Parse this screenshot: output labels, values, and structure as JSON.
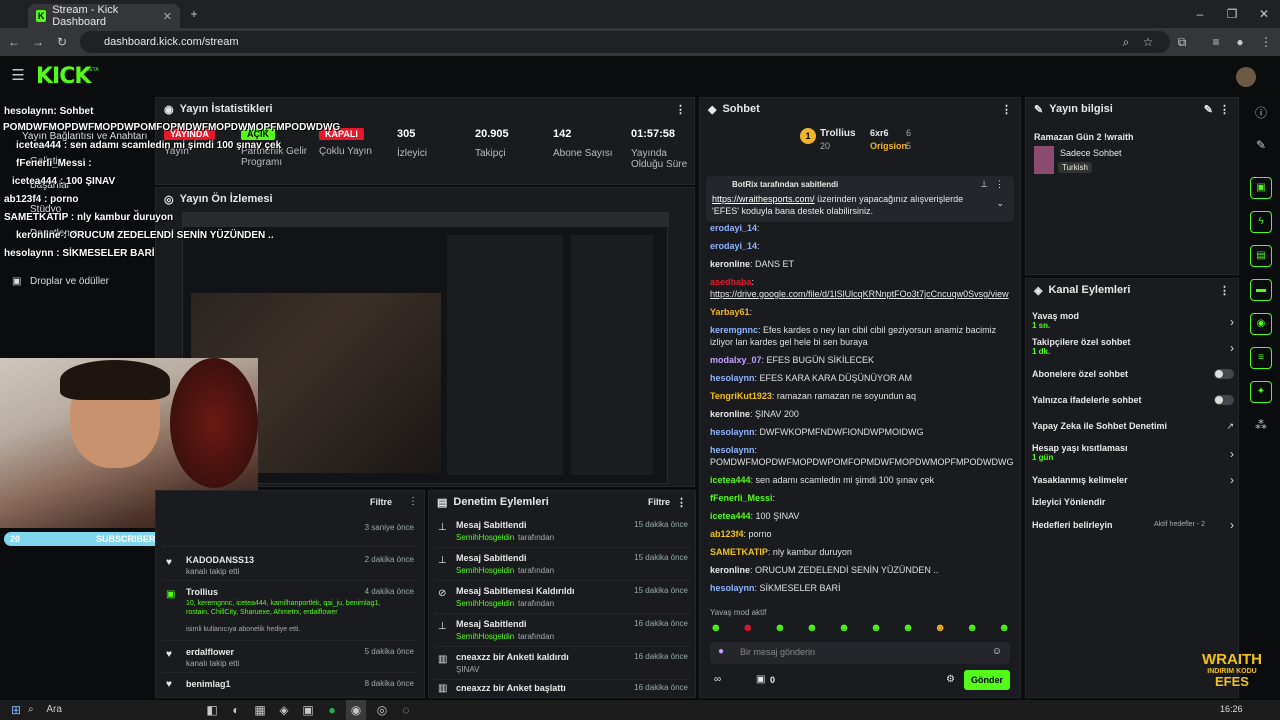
{
  "browser": {
    "tab_title": "Stream - Kick Dashboard",
    "url": "dashboard.kick.com/stream",
    "search_text": "Ara",
    "clock": "16:26"
  },
  "kick": {
    "logo": "KICK",
    "logo_sup": "BETA"
  },
  "nav": {
    "item1": "Yayın Bağlantısı ve Anahtarı",
    "item2": "Geliştir",
    "item3": "Başarılar",
    "item4": "Stüdyo",
    "item5": "Denetleme",
    "item6": "Droplar ve ödüller"
  },
  "stats": {
    "title": "Yayın İstatistikleri",
    "live_badge": "YAYINDA",
    "live_label": "Yayın",
    "partner_badge": "AÇIK",
    "partner_label": "Partnerlik Gelir Programı",
    "multi_badge": "KAPALI",
    "multi_label": "Çoklu Yayın",
    "viewers": "305",
    "viewers_label": "İzleyici",
    "followers": "20.905",
    "followers_label": "Takipçi",
    "subs": "142",
    "subs_label": "Abone Sayısı",
    "uptime": "01:57:58",
    "uptime_label": "Yayında Olduğu Süre"
  },
  "preview": {
    "title": "Yayın Ön İzlemesi"
  },
  "activity": {
    "filter": "Filtre",
    "rows": [
      {
        "name": "",
        "sub": "",
        "time": "3 saniye önce"
      },
      {
        "name": "KADODANSS13",
        "sub": "kanalı takip etti",
        "time": "2 dakika önce"
      },
      {
        "name": "Trollius",
        "sub": "10, keremgnnc, icetea444, kamilhanportlek, qai_ju, benimlag1, rostain, ChillCity, Sharuexe, Ahmetrx, erdalflower",
        "sub2": "isimli kullanıcıya abonelik hediye etti.",
        "time": "4 dakika önce"
      },
      {
        "name": "erdalflower",
        "sub": "kanalı takip etti",
        "time": "5 dakika önce"
      },
      {
        "name": "benimlag1",
        "sub": "",
        "time": "8 dakika önce"
      }
    ]
  },
  "mod": {
    "title": "Denetim Eylemleri",
    "filter": "Filtre",
    "rows": [
      {
        "name": "Mesaj Sabitlendi",
        "by": "SemihHosgeldin",
        "suffix": "tarafından",
        "time": "15 dakika önce"
      },
      {
        "name": "Mesaj Sabitlendi",
        "by": "SemihHosgeldin",
        "suffix": "tarafından",
        "time": "15 dakika önce"
      },
      {
        "name": "Mesaj Sabitlemesi Kaldırıldı",
        "by": "SemihHosgeldin",
        "suffix": "tarafından",
        "time": "15 dakika önce"
      },
      {
        "name": "Mesaj Sabitlendi",
        "by": "SemihHosgeldin",
        "suffix": "tarafından",
        "time": "16 dakika önce"
      },
      {
        "name": "cneaxzz bir Anketi kaldırdı",
        "by": "ŞINAV",
        "suffix": "",
        "time": "16 dakika önce"
      },
      {
        "name": "cneaxzz bir Anket başlattı",
        "by": "",
        "suffix": "",
        "time": "16 dakika önce"
      }
    ]
  },
  "chat": {
    "title": "Sohbet",
    "top_user": "Trollius",
    "top_count": "20",
    "u2": "6xr6",
    "u2c": "6",
    "u3": "Origsion",
    "u3c": "5",
    "pinned_by": "BotRix tarafından sabitlendi",
    "pinned_link": "https://wraithesports.com/",
    "pinned_text": "üzerinden yapacağınız alışverişlerde 'EFES' koduyla bana destek olabilirsiniz.",
    "slow_mode_note": "Yavaş mod aktif",
    "placeholder": "Bir mesaj gönderin",
    "send": "Gönder",
    "points": "0",
    "lines": [
      {
        "user": "erodayi_14",
        "text": ":"
      },
      {
        "user": "erodayi_14",
        "text": ":"
      },
      {
        "user": "keronline",
        "text": ": DANS ET"
      },
      {
        "user": "asedbaba",
        "text": ":"
      },
      {
        "user": "",
        "text": "https://drive.google.com/file/d/1lSlUlcqKRNnptFOo3t7jcCncuqw0Svsg/view"
      },
      {
        "user": "Yarbay61",
        "text": ":"
      },
      {
        "user": "keremgnnc",
        "text": ": Efes kardes o ney lan cibil cibil geziyorsun anamiz bacimiz izliyor lan kardes gel hele bi sen buraya"
      },
      {
        "user": "modalxy_07",
        "text": ": EFES BUGÜN SİKİLECEK"
      },
      {
        "user": "hesolaynn",
        "text": ": EFES KARA KARA DÜŞÜNÜYOR AM"
      },
      {
        "user": "TengriKut1923",
        "text": ": ramazan ramazan ne soyundun aq"
      },
      {
        "user": "keronline",
        "text": ": ŞINAV 200"
      },
      {
        "user": "hesolaynn",
        "text": ": DWFWKOPMFNDWFIONDWPMOIDWG"
      },
      {
        "user": "hesolaynn",
        "text": ": POMDWFMOPDWFMOPDWPOMFOPMDWFMOPDWMOPFMPODWDWG"
      },
      {
        "user": "icetea444",
        "text": ": sen adamı scamledin mi şimdi 100 şınav çek"
      },
      {
        "user": "fFenerli_Messi",
        "text": ":"
      },
      {
        "user": "icetea444",
        "text": ": 100 ŞINAV"
      },
      {
        "user": "ab123f4",
        "text": ": porno"
      },
      {
        "user": "SAMETKATIP",
        "text": ": nly kambur duruyon"
      },
      {
        "user": "keronline",
        "text": ": ORUCUM ZEDELENDİ SENİN YÜZÜNDEN .."
      },
      {
        "user": "hesolaynn",
        "text": ": SİKMESELER BARİ"
      }
    ]
  },
  "info": {
    "title": "Yayın bilgisi",
    "stream_title": "Ramazan Gün 2 !wraith",
    "category": "Sadece Sohbet",
    "language": "Turkish"
  },
  "channel": {
    "title": "Kanal Eylemleri",
    "slow": "Yavaş mod",
    "slow_val": "1 sn.",
    "followers_only": "Takipçilere özel sohbet",
    "followers_val": "1 dk.",
    "subs_only": "Abonelere özel sohbet",
    "emotes_only": "Yalnızca ifadelerle sohbet",
    "ai": "Yapay Zeka ile Sohbet Denetimi",
    "age": "Hesap yaşı kısıtlaması",
    "age_val": "1 gün",
    "banned": "Yasaklanmış kelimeler",
    "redirect": "İzleyici Yönlendir",
    "goals": "Hedefleri belirleyin",
    "goals_val": "Aktif hedefler - 2"
  },
  "overlay": {
    "l1": "hesolaynn: Sohbet",
    "l2": "POMDWFMOPDWFMOPDWPOMFOPMDWFMOPDWMOPFMPODWDWG",
    "l3": "icetea444 : sen adamı scamledin mi şimdi 100 şınav çek",
    "l4": "fFenerli_Messi :",
    "l5": "icetea444 : 100 ŞINAV",
    "l6": "ab123f4 : porno",
    "l7": "SAMETKATIP : nly kambur duruyon",
    "l8": "keronline : ORUCUM ZEDELENDİ SENİN YÜZÜNDEN ..",
    "l9": "hesolaynn : SİKMESELER BARİ",
    "sub_left": "20",
    "sub_label": "SUBSCRIBERS",
    "sub_right": "7",
    "wraith": "WRAITH",
    "wraith2": "INDIRIM KODU",
    "wraith3": "EFES"
  },
  "colors": {
    "kick_green": "#53fc18",
    "panel": "#191b1f",
    "bg": "#0b0c0d"
  }
}
